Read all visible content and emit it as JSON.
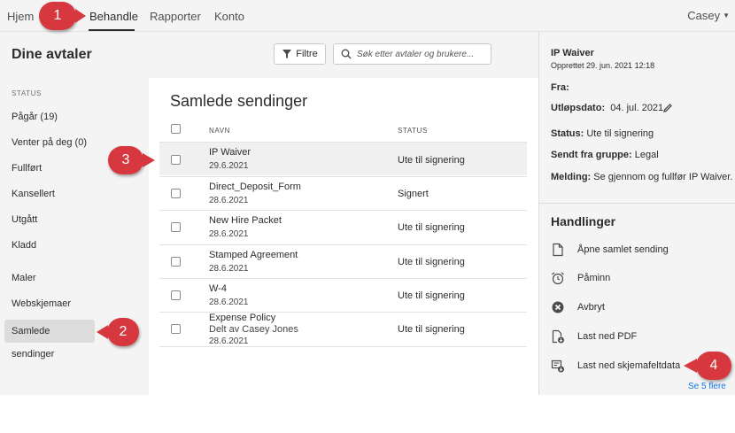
{
  "nav": {
    "home": "Hjem",
    "manage": "Behandle",
    "reports": "Rapporter",
    "account": "Konto",
    "user": "Casey"
  },
  "toolbar": {
    "title": "Dine avtaler",
    "filter_label": "Filtre",
    "search_placeholder": "Søk etter avtaler og brukere..."
  },
  "sidebar": {
    "status_heading": "STATUS",
    "items": [
      "Pågår (19)",
      "Venter på deg (0)",
      "Fullført",
      "Kansellert",
      "Utgått",
      "Kladd",
      "Maler",
      "Webskjemaer",
      "Samlede sendinger"
    ]
  },
  "main": {
    "title": "Samlede sendinger",
    "col_name": "NAVN",
    "col_status": "STATUS",
    "rows": [
      {
        "name": "IP Waiver",
        "sub": "29.6.2021",
        "status": "Ute til signering"
      },
      {
        "name": "Direct_Deposit_Form",
        "sub": "28.6.2021",
        "status": "Signert"
      },
      {
        "name": "New Hire Packet",
        "sub": "28.6.2021",
        "status": "Ute til signering"
      },
      {
        "name": "Stamped Agreement",
        "sub": "28.6.2021",
        "status": "Ute til signering"
      },
      {
        "name": "W-4",
        "sub": "28.6.2021",
        "status": "Ute til signering"
      },
      {
        "name": "Expense Policy",
        "shared": "Delt av Casey Jones",
        "sub": "28.6.2021",
        "status": "Ute til signering"
      }
    ]
  },
  "details": {
    "title": "IP Waiver",
    "created": "Opprettet 29. jun. 2021 12:18",
    "from_label": "Fra:",
    "expiry_label": "Utløpsdato:",
    "expiry_value": "04. jul. 2021",
    "status_label": "Status:",
    "status_value": "Ute til signering",
    "group_label": "Sendt fra gruppe:",
    "group_value": "Legal",
    "message_label": "Melding:",
    "message_value": "Se gjennom og fullfør IP Waiver.",
    "actions_title": "Handlinger",
    "actions": [
      {
        "label": "Åpne samlet sending",
        "icon": "document-icon"
      },
      {
        "label": "Påminn",
        "icon": "alarm-clock-icon"
      },
      {
        "label": "Avbryt",
        "icon": "cancel-circle-icon"
      },
      {
        "label": "Last ned PDF",
        "icon": "download-pdf-icon"
      },
      {
        "label": "Last ned skjemafeltdata",
        "icon": "download-data-icon"
      }
    ],
    "see_more": "Se 5 flere"
  },
  "callouts": [
    "1",
    "2",
    "3",
    "4"
  ],
  "colors": {
    "callout": "#d7373f",
    "link": "#1473e6",
    "panel_bg": "#f4f4f4"
  }
}
